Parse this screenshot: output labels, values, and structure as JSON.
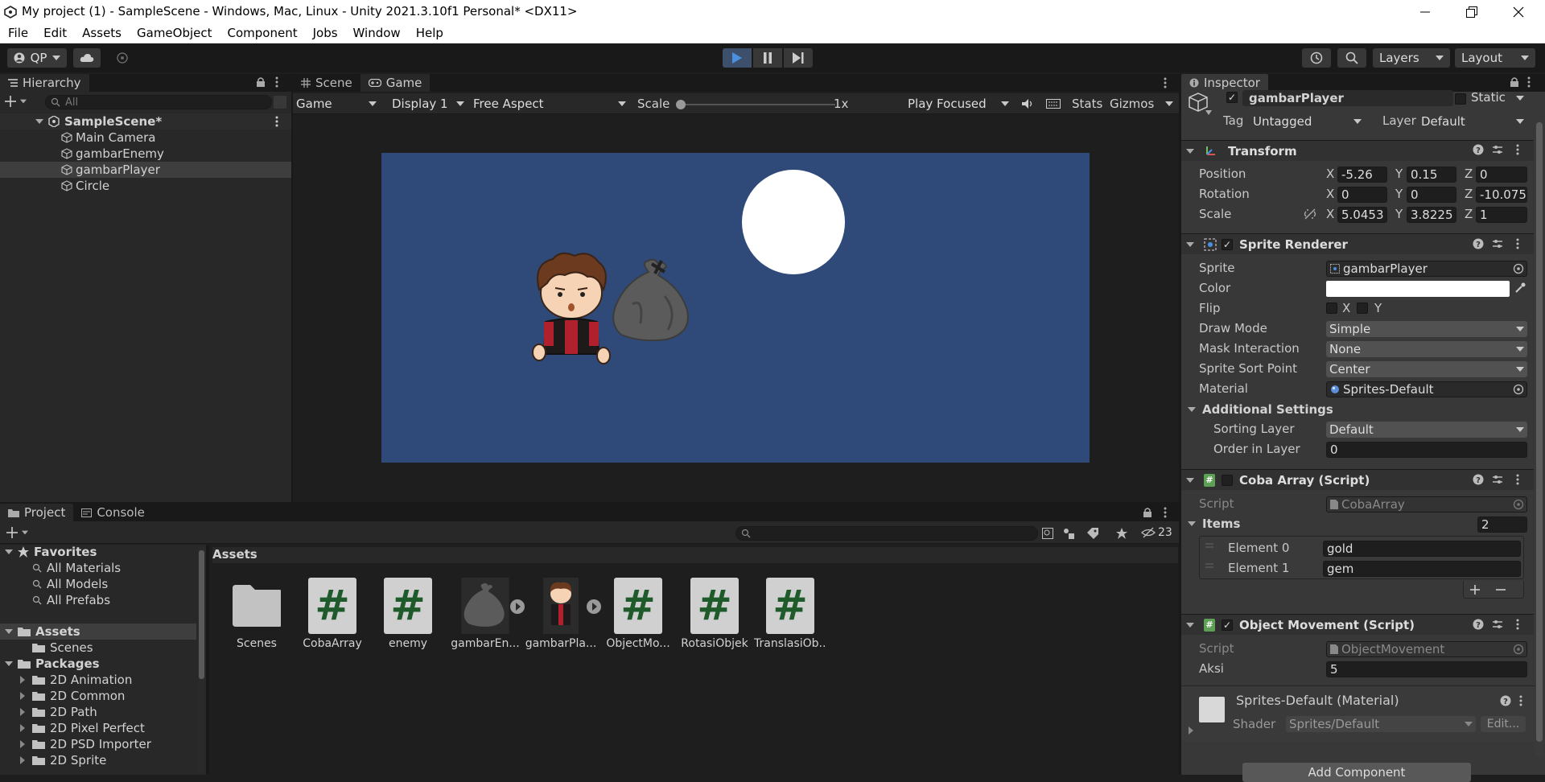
{
  "window": {
    "title": "My project (1) - SampleScene - Windows, Mac, Linux - Unity 2021.3.10f1 Personal* <DX11>",
    "icons": [
      "unity-logo-icon",
      "minimize-icon",
      "restore-icon",
      "close-icon"
    ]
  },
  "menu": [
    "File",
    "Edit",
    "Assets",
    "GameObject",
    "Component",
    "Jobs",
    "Window",
    "Help"
  ],
  "toolbar": {
    "account": "QP",
    "layers": "Layers",
    "layout": "Layout",
    "accent": "#3e4f6c"
  },
  "hierarchy": {
    "tab": "Hierarchy",
    "search_placeholder": "All",
    "scene": "SampleScene*",
    "items": [
      "Main Camera",
      "gambarEnemy",
      "gambarPlayer",
      "Circle"
    ],
    "selected": "gambarPlayer"
  },
  "game_view": {
    "tabs": [
      "Scene",
      "Game"
    ],
    "active_tab": "Game",
    "mode": "Game",
    "display": "Display 1",
    "aspect": "Free Aspect",
    "scale_label": "Scale",
    "scale_value": "1x",
    "play_focused": "Play Focused",
    "stats": "Stats",
    "gizmos": "Gizmos",
    "background": "#2f4a79"
  },
  "project": {
    "tabs": [
      "Project",
      "Console"
    ],
    "count": "23",
    "favorites_label": "Favorites",
    "favorites": [
      "All Materials",
      "All Models",
      "All Prefabs"
    ],
    "assets_label": "Assets",
    "assets_children": [
      "Scenes"
    ],
    "packages_label": "Packages",
    "packages": [
      "2D Animation",
      "2D Common",
      "2D Path",
      "2D Pixel Perfect",
      "2D PSD Importer",
      "2D Sprite"
    ],
    "breadcrumb": "Assets",
    "items": [
      {
        "name": "Scenes",
        "kind": "folder"
      },
      {
        "name": "CobaArray",
        "kind": "script"
      },
      {
        "name": "enemy",
        "kind": "script"
      },
      {
        "name": "gambarEn...",
        "kind": "sprite-bag"
      },
      {
        "name": "gambarPla...",
        "kind": "sprite-player"
      },
      {
        "name": "ObjectMo...",
        "kind": "script"
      },
      {
        "name": "RotasiObjek",
        "kind": "script"
      },
      {
        "name": "TranslasiOb...",
        "kind": "script"
      }
    ]
  },
  "inspector": {
    "tab": "Inspector",
    "object_name": "gambarPlayer",
    "static_label": "Static",
    "tag_label": "Tag",
    "tag_value": "Untagged",
    "layer_label": "Layer",
    "layer_value": "Default",
    "transform": {
      "title": "Transform",
      "position_label": "Position",
      "rotation_label": "Rotation",
      "scale_label": "Scale",
      "position": [
        "-5.26",
        "0.15",
        "0"
      ],
      "rotation": [
        "0",
        "0",
        "-10.075"
      ],
      "scale": [
        "5.0453",
        "3.8225",
        "1"
      ],
      "axes": [
        "X",
        "Y",
        "Z"
      ]
    },
    "sprite_renderer": {
      "title": "Sprite Renderer",
      "sprite_label": "Sprite",
      "sprite_value": "gambarPlayer",
      "color_label": "Color",
      "color_value": "#ffffff",
      "flip_label": "Flip",
      "flip_x": "X",
      "flip_y": "Y",
      "draw_mode_label": "Draw Mode",
      "draw_mode_value": "Simple",
      "mask_label": "Mask Interaction",
      "mask_value": "None",
      "sort_point_label": "Sprite Sort Point",
      "sort_point_value": "Center",
      "material_label": "Material",
      "material_value": "Sprites-Default",
      "additional_label": "Additional Settings",
      "sorting_layer_label": "Sorting Layer",
      "sorting_layer_value": "Default",
      "order_label": "Order in Layer",
      "order_value": "0"
    },
    "coba_array": {
      "title": "Coba Array (Script)",
      "script_label": "Script",
      "script_value": "CobaArray",
      "items_label": "Items",
      "items_count": "2",
      "elements": [
        {
          "label": "Element 0",
          "value": "gold"
        },
        {
          "label": "Element 1",
          "value": "gem"
        }
      ]
    },
    "object_movement": {
      "title": "Object Movement (Script)",
      "script_label": "Script",
      "script_value": "ObjectMovement",
      "aksi_label": "Aksi",
      "aksi_value": "5"
    },
    "material": {
      "title": "Sprites-Default (Material)",
      "shader_label": "Shader",
      "shader_value": "Sprites/Default",
      "edit_label": "Edit..."
    },
    "add_component": "Add Component"
  }
}
